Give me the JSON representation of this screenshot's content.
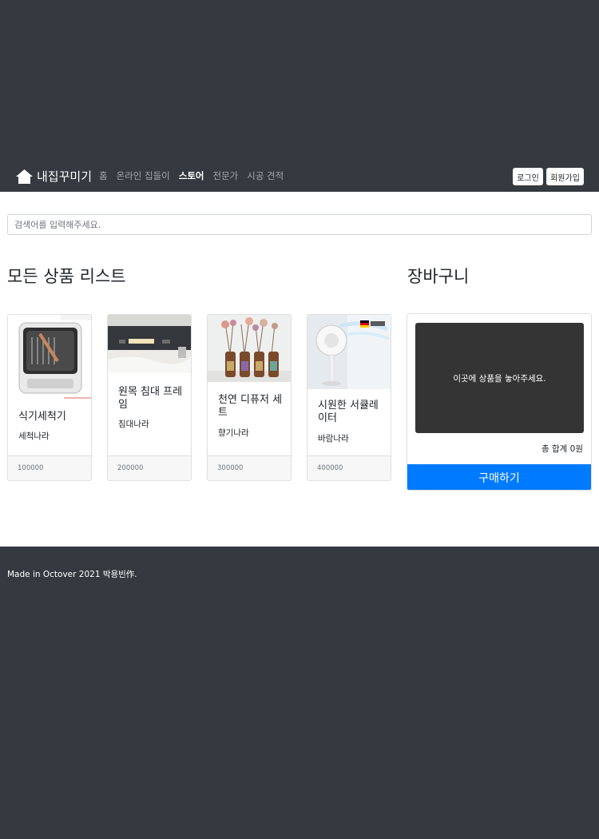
{
  "navbar": {
    "brand": "내집꾸미기",
    "links": [
      {
        "label": "홈",
        "active": false
      },
      {
        "label": "온라인 집들이",
        "active": false
      },
      {
        "label": "스토어",
        "active": true
      },
      {
        "label": "전문가",
        "active": false
      },
      {
        "label": "시공 견적",
        "active": false
      }
    ],
    "login_label": "로그인",
    "signup_label": "회원가입"
  },
  "search": {
    "placeholder": "검색어를 입력해주세요."
  },
  "products": {
    "title": "모든 상품 리스트",
    "items": [
      {
        "name": "식기세척기",
        "brand": "세척나라",
        "price": "100000",
        "image": "dishwasher"
      },
      {
        "name": "원목 침대 프레임",
        "brand": "침대나라",
        "price": "200000",
        "image": "bed-frame"
      },
      {
        "name": "천연 디퓨저 세트",
        "brand": "향기나라",
        "price": "300000",
        "image": "diffuser-set"
      },
      {
        "name": "시원한 서큘레이터",
        "brand": "바람나라",
        "price": "400000",
        "image": "circulator"
      }
    ]
  },
  "cart": {
    "title": "장바구니",
    "drop_text": "이곳에 상품을 놓아주세요.",
    "total_text": "총 합계 0원",
    "buy_label": "구매하기"
  },
  "footer": {
    "text": "Made in Octover 2021 박용빈作."
  },
  "colors": {
    "dark": "#343a40",
    "primary": "#007bff",
    "cart_drop": "#343434"
  }
}
